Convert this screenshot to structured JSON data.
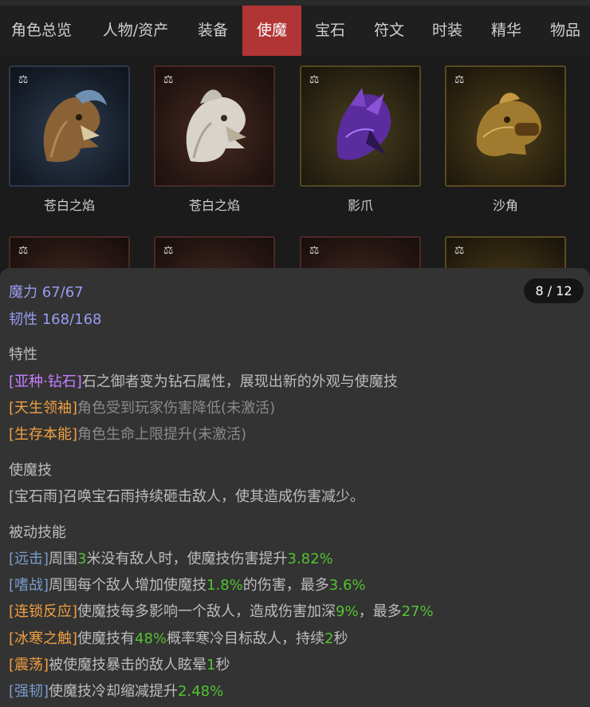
{
  "tabs": [
    {
      "label": "角色总览"
    },
    {
      "label": "人物/资产"
    },
    {
      "label": "装备"
    },
    {
      "label": "使魔",
      "active": true
    },
    {
      "label": "宝石"
    },
    {
      "label": "符文"
    },
    {
      "label": "时装"
    },
    {
      "label": "精华"
    },
    {
      "label": "物品"
    }
  ],
  "familiars": [
    {
      "name": "苍白之焰",
      "frame": "blue",
      "icon": "griffin-brown-icon"
    },
    {
      "name": "苍白之焰",
      "frame": "red",
      "icon": "griffin-white-icon"
    },
    {
      "name": "影爪",
      "frame": "gold",
      "icon": "shadow-claw-icon"
    },
    {
      "name": "沙角",
      "frame": "gold2",
      "icon": "sand-horn-icon"
    }
  ],
  "colors": {
    "accent_tab": "#b23535",
    "stat": "#9a9cf0",
    "trait_purple": "#c77dff",
    "trait_orange": "#f0a040",
    "skill_blue": "#7a9ccc",
    "number_green": "#53c233"
  },
  "detail": {
    "pager": "8 / 12",
    "stats": {
      "mana_label": "魔力",
      "mana_value": "67/67",
      "tough_label": "韧性",
      "tough_value": "168/168"
    },
    "traits_title": "特性",
    "traits": {
      "t1_tag": "[亚种·钻石]",
      "t1_text": "石之御者变为钻石属性，展现出新的外观与使魔技",
      "t2_tag": "[天生领袖]",
      "t2_text": "角色受到玩家伤害降低(未激活)",
      "t3_tag": "[生存本能]",
      "t3_text": "角色生命上限提升(未激活)"
    },
    "skill_title": "使魔技",
    "skill_text": "[宝石雨]召唤宝石雨持续砸击敌人，使其造成伤害减少。",
    "passives_title": "被动技能",
    "passives": {
      "p1_tag": "[远击]",
      "p1_a": "周围",
      "p1_n1": "3",
      "p1_b": "米没有敌人时，使魔技伤害提升",
      "p1_n2": "3.82%",
      "p2_tag": "[嗜战]",
      "p2_a": "周围每个敌人增加使魔技",
      "p2_n1": "1.8%",
      "p2_b": "的伤害，最多",
      "p2_n2": "3.6%",
      "p3_tag": "[连锁反应]",
      "p3_a": "使魔技每多影响一个敌人，造成伤害加深",
      "p3_n1": "9%",
      "p3_b": "，最多",
      "p3_n2": "27%",
      "p4_tag": "[冰寒之触]",
      "p4_a": "使魔技有",
      "p4_n1": "48%",
      "p4_b": "概率寒冷目标敌人，持续",
      "p4_n2": "2",
      "p4_c": "秒",
      "p5_tag": "[震荡]",
      "p5_a": "被使魔技暴击的敌人眩晕",
      "p5_n1": "1",
      "p5_b": "秒",
      "p6_tag": "[强韧]",
      "p6_a": "使魔技冷却缩减提升",
      "p6_n1": "2.48%"
    }
  }
}
